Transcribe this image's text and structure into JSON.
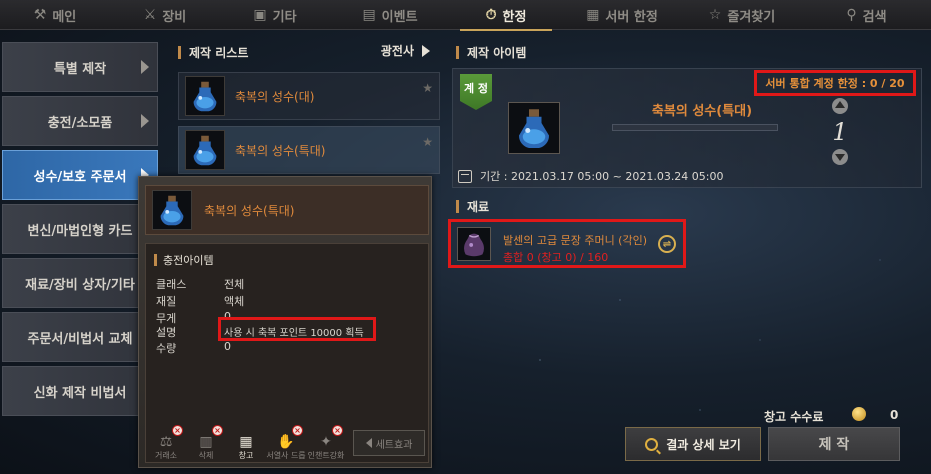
{
  "tabs": [
    {
      "label": "메인",
      "icon": "anvil-icon"
    },
    {
      "label": "장비",
      "icon": "crossed-swords-icon"
    },
    {
      "label": "기타",
      "icon": "box-icon"
    },
    {
      "label": "이벤트",
      "icon": "gift-icon"
    },
    {
      "label": "한정",
      "icon": "stopwatch-icon",
      "active": true
    },
    {
      "label": "서버 한정",
      "icon": "server-icon"
    },
    {
      "label": "즐겨찾기",
      "icon": "star-icon"
    },
    {
      "label": "검색",
      "icon": "search-icon"
    }
  ],
  "sidebar": {
    "items": [
      {
        "label": "특별 제작"
      },
      {
        "label": "충전/소모품"
      },
      {
        "label": "성수/보호 주문서",
        "active": true
      },
      {
        "label": "변신/마법인형 카드"
      },
      {
        "label": "재료/장비 상자/기타"
      },
      {
        "label": "주문서/비법서 교체"
      },
      {
        "label": "신화 제작 비법서"
      }
    ]
  },
  "craft_list": {
    "title": "제작 리스트",
    "filter": "광전사",
    "items": [
      {
        "name": "축복의 성수(대)"
      },
      {
        "name": "축복의 성수(특대)"
      }
    ]
  },
  "craft_item": {
    "title": "제작 아이템",
    "limit": "서버 통합 계정 한정 : 0 / 20",
    "grade": "계 정",
    "name": "축복의 성수(특대)",
    "quantity": "1",
    "period": "기간 : 2021.03.17 05:00 ~ 2021.03.24 05:00"
  },
  "materials": {
    "title": "재료",
    "item_name": "발센의 고급 문장 주머니 (각인)",
    "count": "총합 0 (창고 0) / 160"
  },
  "detail": {
    "name": "축복의 성수(특대)",
    "category": "충전아이템",
    "attrs": [
      {
        "key": "클래스",
        "value": "전체"
      },
      {
        "key": "재질",
        "value": "액체"
      },
      {
        "key": "무게",
        "value": "0"
      },
      {
        "key": "설명",
        "value": "사용 시 축복 포인트 10000 획득"
      },
      {
        "key": "수량",
        "value": "0"
      }
    ],
    "actions": [
      {
        "label": "거래소",
        "icon": "exchange-icon",
        "allowed": false
      },
      {
        "label": "삭제",
        "icon": "trash-icon",
        "allowed": false
      },
      {
        "label": "창고",
        "icon": "warehouse-icon",
        "allowed": true
      },
      {
        "label": "서열사 드롭",
        "icon": "drop-icon",
        "allowed": false
      },
      {
        "label": "인챈트강화",
        "icon": "enchant-icon",
        "allowed": false
      }
    ],
    "set_effect": "세트효과"
  },
  "footer": {
    "fee_label": "창고 수수료",
    "fee_value": "0",
    "detail_button": "결과 상세 보기",
    "craft_button": "제 작"
  },
  "colors": {
    "accent_orange": "#e08a3c",
    "highlight_red": "#e01818",
    "active_blue": "#3a78bc",
    "tab_underline": "#c9a45a"
  }
}
